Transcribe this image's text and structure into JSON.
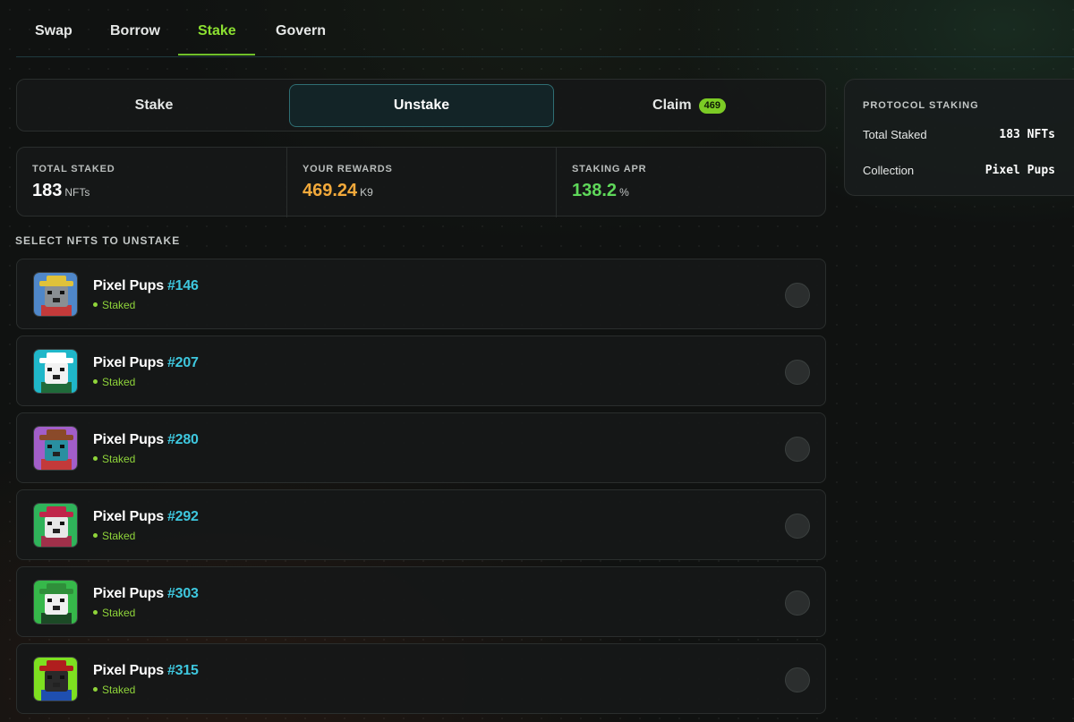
{
  "nav": {
    "tabs": [
      {
        "label": "Swap"
      },
      {
        "label": "Borrow"
      },
      {
        "label": "Stake"
      },
      {
        "label": "Govern"
      }
    ],
    "active": "Stake"
  },
  "segment": {
    "options": [
      {
        "label": "Stake"
      },
      {
        "label": "Unstake"
      },
      {
        "label": "Claim",
        "badge": "469"
      }
    ],
    "active": "Unstake"
  },
  "stats": [
    {
      "label": "TOTAL STAKED",
      "value": "183",
      "unit": "NFTs",
      "color": "#ffffff"
    },
    {
      "label": "YOUR REWARDS",
      "value": "469.24",
      "unit": "K9",
      "color": "#f2a93b"
    },
    {
      "label": "STAKING APR",
      "value": "138.2",
      "unit": "%",
      "color": "#5fd85a"
    }
  ],
  "list": {
    "title": "SELECT NFTS TO UNSTAKE",
    "items": [
      {
        "name": "Pixel Pups",
        "number": "#146",
        "status": "Staked",
        "avatar_bg": "#4f87c9",
        "hat": "#e0c23a",
        "body": "#c33a3a",
        "fur": "#8a8f93"
      },
      {
        "name": "Pixel Pups",
        "number": "#207",
        "status": "Staked",
        "avatar_bg": "#1fb7c9",
        "hat": "#ffffff",
        "body": "#1f6b3a",
        "fur": "#f2f2f2"
      },
      {
        "name": "Pixel Pups",
        "number": "#280",
        "status": "Staked",
        "avatar_bg": "#a25ec9",
        "hat": "#8a4a2a",
        "body": "#c33a3a",
        "fur": "#2a8fa0"
      },
      {
        "name": "Pixel Pups",
        "number": "#292",
        "status": "Staked",
        "avatar_bg": "#2fb35a",
        "hat": "#c0264a",
        "body": "#a0304a",
        "fur": "#e8e8e8"
      },
      {
        "name": "Pixel Pups",
        "number": "#303",
        "status": "Staked",
        "avatar_bg": "#36b84a",
        "hat": "#2f8f3a",
        "body": "#1c4a26",
        "fur": "#f0f0f0"
      },
      {
        "name": "Pixel Pups",
        "number": "#315",
        "status": "Staked",
        "avatar_bg": "#7ee020",
        "hat": "#b01e1e",
        "body": "#1f4fb0",
        "fur": "#2a2a2a"
      }
    ]
  },
  "protocol": {
    "title": "PROTOCOL STAKING",
    "rows": [
      {
        "key": "Total Staked",
        "value": "183 NFTs"
      },
      {
        "key": "Collection",
        "value": "Pixel Pups"
      }
    ]
  }
}
